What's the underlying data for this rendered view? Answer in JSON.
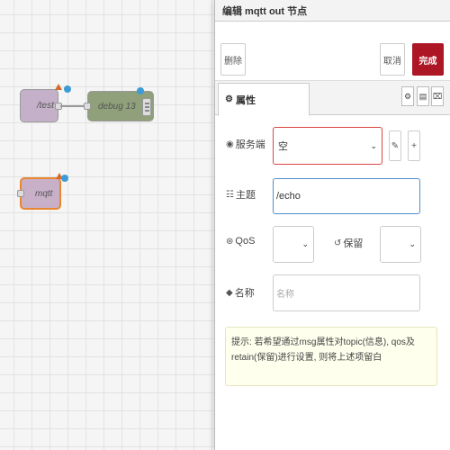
{
  "workspace": {
    "nodes": {
      "inject_label": "/test",
      "debug_label": "debug 13",
      "mqtt_label": "mqtt"
    },
    "colors": {
      "inject": "#c4b0c8",
      "debug": "#8fa07a",
      "mqtt_border": "#e8872f",
      "status_dot": "#3c9bd6",
      "changed_marker": "#d46a2e"
    }
  },
  "tray": {
    "title": "编辑 mqtt out 节点",
    "toolbar": {
      "delete_label": "删除",
      "cancel_label": "取消",
      "done_label": "完成"
    },
    "tabs": {
      "properties_label": "属性",
      "properties_icon": "gear-icon",
      "icon_tabs": [
        "gear-icon",
        "description-icon",
        "appearance-icon"
      ]
    },
    "form": {
      "server": {
        "label": "服务端",
        "value": "空",
        "icon": "globe-icon"
      },
      "topic": {
        "label": "主题",
        "value": "/echo",
        "icon": "tasks-icon"
      },
      "qos": {
        "label": "QoS",
        "value": "",
        "icon": "empire-icon"
      },
      "retain": {
        "label": "保留",
        "value": "",
        "icon": "history-icon"
      },
      "name": {
        "label": "名称",
        "placeholder": "名称",
        "icon": "tag-icon"
      }
    },
    "tip": "提示: 若希望通过msg属性对topic(信息), qos及retain(保留)进行设置, 则将上述项留白"
  },
  "colors": {
    "done_button": "#ad1625",
    "error_border": "#dd4444",
    "focus_border": "#4c8fcf"
  }
}
